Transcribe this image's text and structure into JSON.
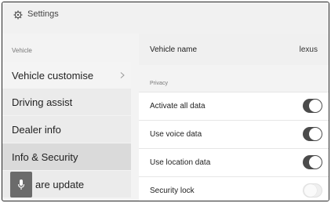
{
  "header": {
    "title": "Settings",
    "icon": "gear-icon"
  },
  "sidebar": {
    "section": "Vehicle",
    "items": [
      {
        "label": "Vehicle customise"
      },
      {
        "label": "Driving assist"
      },
      {
        "label": "Dealer info"
      },
      {
        "label": "Info & Security"
      },
      {
        "label": "are update"
      }
    ]
  },
  "main": {
    "vehicle_name": {
      "label": "Vehicle name",
      "value": "lexus"
    },
    "privacy_section": "Privacy",
    "toggles": [
      {
        "label": "Activate all data",
        "state": "on"
      },
      {
        "label": "Use voice data",
        "state": "on"
      },
      {
        "label": "Use location data",
        "state": "on"
      },
      {
        "label": "Security lock",
        "state": "off"
      }
    ]
  },
  "mic_button": {
    "icon": "microphone-icon"
  },
  "colors": {
    "toggle_on": "#4b4b4b",
    "active_item": "#dadada",
    "panel": "#f3f3f3"
  }
}
